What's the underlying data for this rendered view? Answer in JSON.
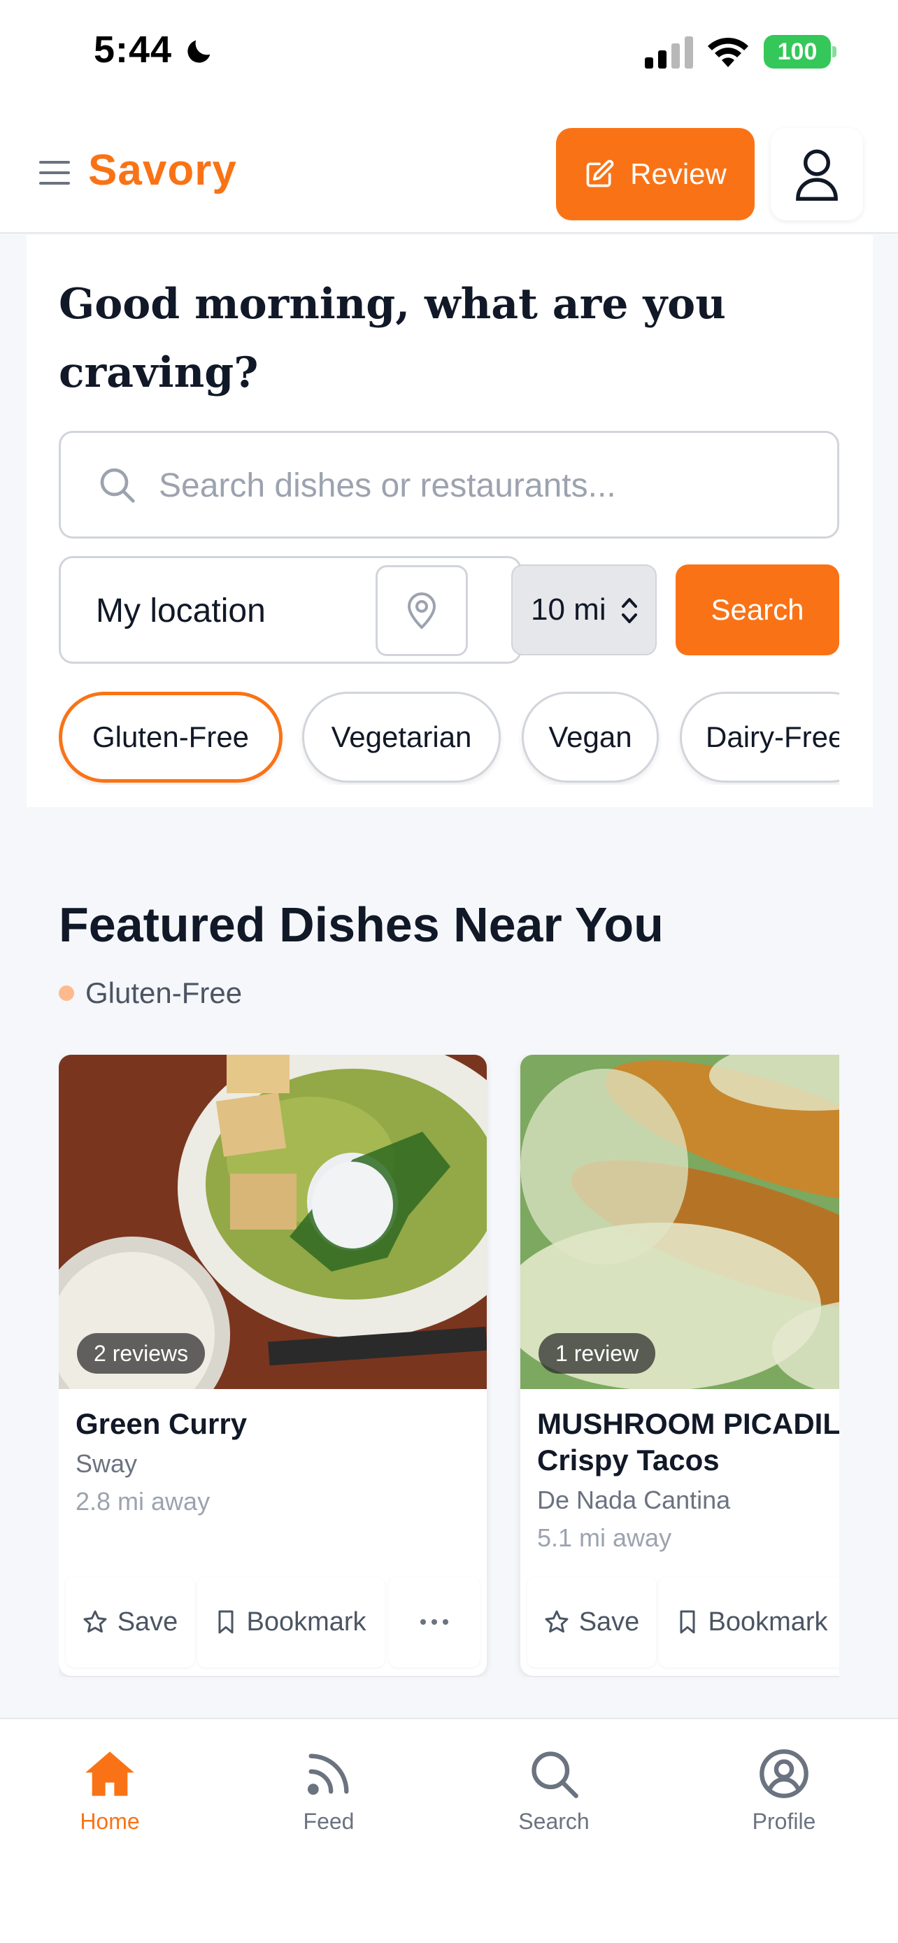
{
  "status_bar": {
    "time": "5:44",
    "battery": "100"
  },
  "header": {
    "logo": "Savory",
    "review_label": "Review"
  },
  "hero": {
    "greeting": "Good morning, what are you craving?",
    "search_placeholder": "Search dishes or restaurants...",
    "location_value": "My location",
    "distance_value": "10 mi",
    "search_label": "Search",
    "chips": [
      {
        "label": "Gluten-Free",
        "active": true
      },
      {
        "label": "Vegetarian",
        "active": false
      },
      {
        "label": "Vegan",
        "active": false
      },
      {
        "label": "Dairy-Free",
        "active": false
      }
    ]
  },
  "featured": {
    "title": "Featured Dishes Near You",
    "filter": "Gluten-Free",
    "cards": [
      {
        "badge": "2 reviews",
        "name": "Green Curry",
        "restaurant": "Sway",
        "distance": "2.8 mi away",
        "save": "Save",
        "bookmark": "Bookmark"
      },
      {
        "badge": "1 review",
        "name": "MUSHROOM PICADILLO\nCrispy Tacos",
        "restaurant": "De Nada Cantina",
        "distance": "5.1 mi away",
        "save": "Save",
        "bookmark": "Bookmark"
      }
    ]
  },
  "tabbar": {
    "tabs": [
      {
        "label": "Home",
        "icon": "home-icon",
        "active": true
      },
      {
        "label": "Feed",
        "icon": "feed-icon",
        "active": false
      },
      {
        "label": "Search",
        "icon": "search-icon",
        "active": false
      },
      {
        "label": "Profile",
        "icon": "profile-icon",
        "active": false
      }
    ]
  },
  "colors": {
    "accent": "#f97316",
    "background": "#f5f7fa",
    "text": "#111827"
  }
}
